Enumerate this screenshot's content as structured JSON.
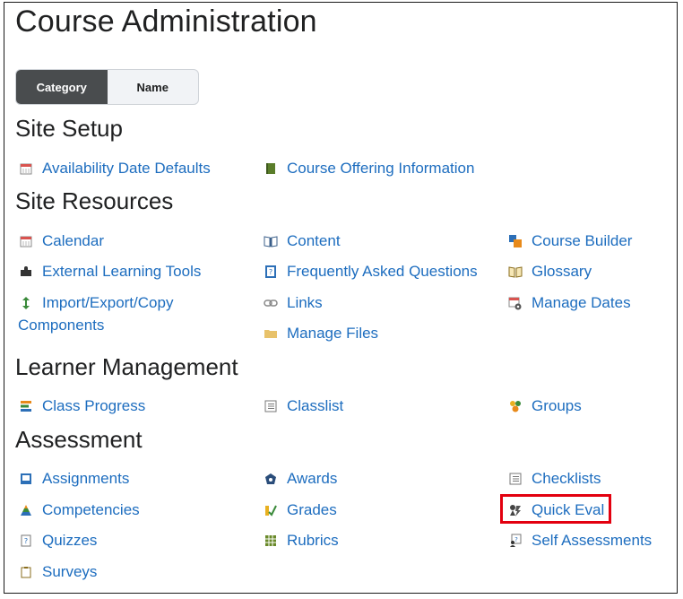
{
  "page": {
    "title": "Course Administration"
  },
  "toggle": {
    "category_label": "Category",
    "name_label": "Name",
    "selected": "Category"
  },
  "sections": {
    "site_setup": "Site Setup",
    "site_resources": "Site Resources",
    "learner_management": "Learner Management",
    "assessment": "Assessment"
  },
  "links": {
    "availability_date_defaults": "Availability Date Defaults",
    "course_offering_information": "Course Offering Information",
    "calendar": "Calendar",
    "content": "Content",
    "course_builder": "Course Builder",
    "external_learning_tools": "External Learning Tools",
    "frequently_asked_questions": "Frequently Asked Questions",
    "glossary": "Glossary",
    "import_export_copy_line1": "Import/Export/Copy",
    "import_export_copy_line2": "Components",
    "links": "Links",
    "manage_dates": "Manage Dates",
    "manage_files": "Manage Files",
    "class_progress": "Class Progress",
    "classlist": "Classlist",
    "groups": "Groups",
    "assignments": "Assignments",
    "awards": "Awards",
    "checklists": "Checklists",
    "competencies": "Competencies",
    "grades": "Grades",
    "quick_eval": "Quick Eval",
    "quizzes": "Quizzes",
    "rubrics": "Rubrics",
    "self_assessments": "Self Assessments",
    "surveys": "Surveys"
  },
  "highlight": {
    "target": "quick_eval",
    "color": "#e3000f"
  },
  "colors": {
    "link": "#1d6dbf",
    "heading": "#202122",
    "toggle_active_bg": "#494c4e"
  }
}
